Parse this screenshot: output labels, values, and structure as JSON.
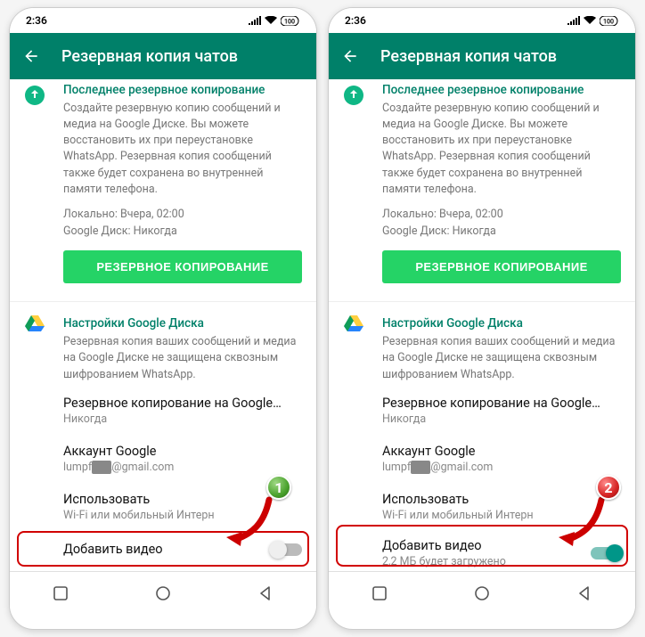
{
  "statusbar": {
    "time": "2:36"
  },
  "appbar": {
    "title": "Резервная копия чатов"
  },
  "lastBackup": {
    "title": "Последнее резервное копирование",
    "desc": "Создайте резервную копию сообщений и медиа на Google Диске. Вы можете восстановить их при переустановке WhatsApp. Резервная копия сообщений также будет сохранена во внутренней памяти телефона.",
    "local": "Локально: Вчера, 02:00",
    "drive": "Google Диск: Никогда",
    "button": "РЕЗЕРВНОЕ КОПИРОВАНИЕ"
  },
  "driveSettings": {
    "title": "Настройки Google Диска",
    "desc": "Резервная копия ваших сообщений и медиа на Google Диске не защищена сквозным шифрованием WhatsApp."
  },
  "backupTo": {
    "title": "Резервное копирование на Google…",
    "sub": "Никогда"
  },
  "account": {
    "title": "Аккаунт Google",
    "emailPrefix": "lumpf",
    "emailMask": "………",
    "emailSuffix": "@gmail.com"
  },
  "network": {
    "title": "Использовать",
    "sub": "Wi-Fi или мобильный Интерн"
  },
  "addVideo": {
    "title": "Добавить видео",
    "subOn": "2,2 МБ будет загружено"
  },
  "badges": {
    "one": "1",
    "two": "2"
  }
}
